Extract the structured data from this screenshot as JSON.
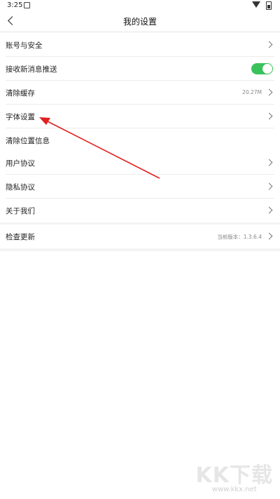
{
  "status_bar": {
    "time": "3:25"
  },
  "header": {
    "title": "我的设置"
  },
  "groups": [
    {
      "rows": [
        {
          "label": "账号与安全"
        },
        {
          "label": "接收新消息推送",
          "toggle": true
        },
        {
          "label": "清除缓存",
          "value": "20.27M"
        },
        {
          "label": "字体设置"
        },
        {
          "label": "清除位置信息"
        }
      ]
    },
    {
      "rows": [
        {
          "label": "用户协议"
        },
        {
          "label": "隐私协议"
        },
        {
          "label": "关于我们"
        }
      ]
    },
    {
      "rows": [
        {
          "label": "检查更新",
          "value": "当前版本：1.3.6.4"
        }
      ]
    }
  ],
  "colors": {
    "toggle_on": "#39c25a",
    "annotation_arrow": "#e02020",
    "separator": "#f4f4f4"
  },
  "watermark": {
    "logo": "KK下载",
    "url": "www.kkx.net"
  }
}
